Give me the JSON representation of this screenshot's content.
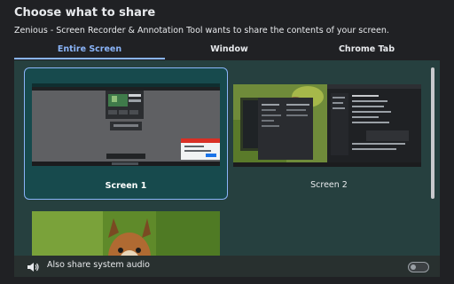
{
  "dialog": {
    "title": "Choose what to share",
    "subtitle": "Zenious - Screen Recorder & Annotation Tool wants to share the contents of your screen."
  },
  "tabs": [
    {
      "label": "Entire Screen",
      "active": true
    },
    {
      "label": "Window",
      "active": false
    },
    {
      "label": "Chrome Tab",
      "active": false
    }
  ],
  "screens": [
    {
      "label": "Screen 1",
      "selected": true
    },
    {
      "label": "Screen 2",
      "selected": false
    },
    {
      "label": "",
      "selected": false
    }
  ],
  "footer": {
    "audio_label": "Also share system audio",
    "audio_icon": "speaker-icon",
    "toggle_on": false
  },
  "colors": {
    "background": "#202124",
    "accent": "#8ab4f8",
    "content": "#26403f",
    "selected_card": "#174a4d"
  }
}
